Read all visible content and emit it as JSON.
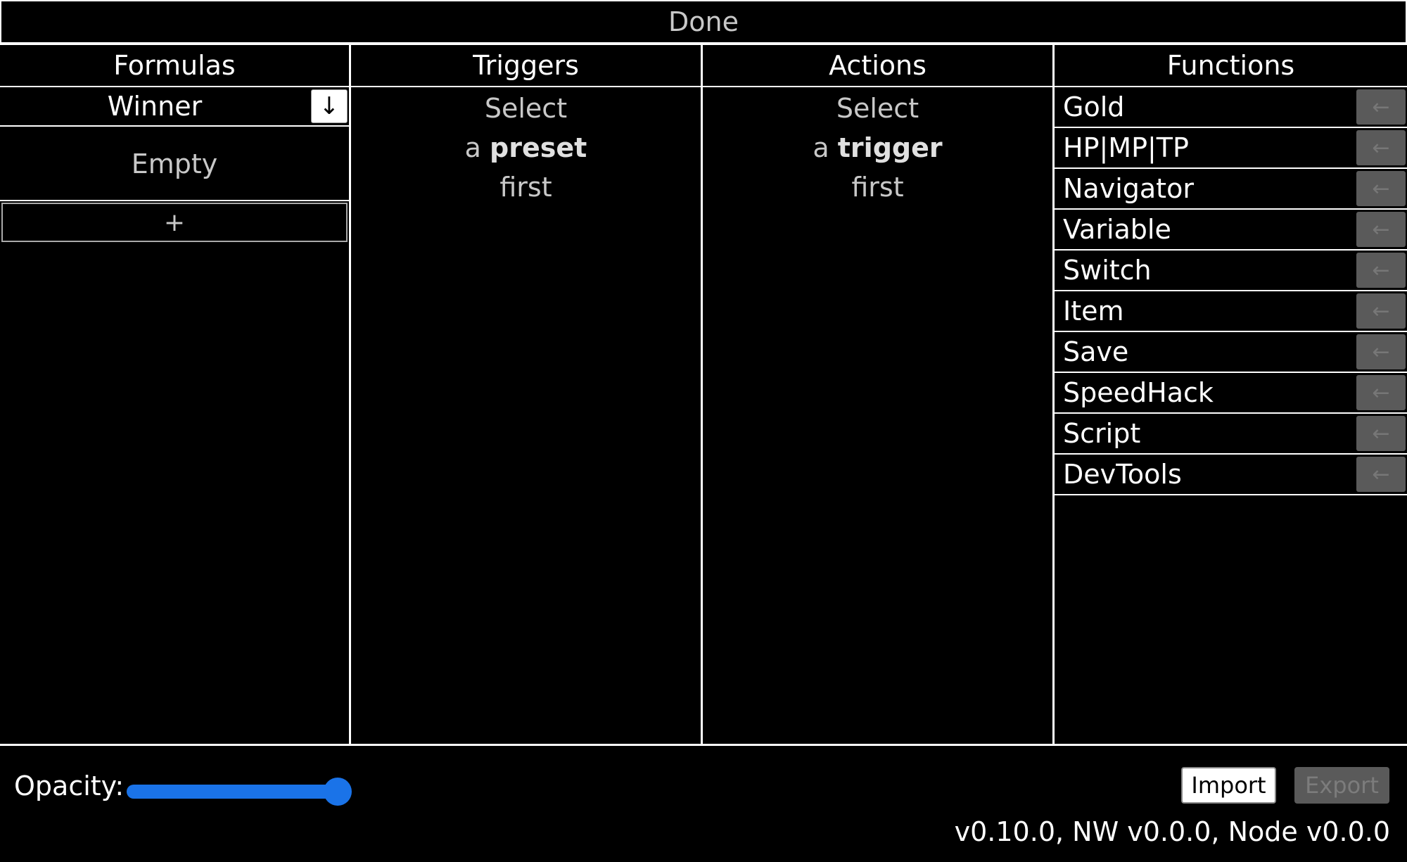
{
  "done_bar": {
    "label": "Done"
  },
  "columns": {
    "formulas": {
      "title": "Formulas",
      "selected": "Winner",
      "download_icon": "↓",
      "empty_text": "Empty",
      "add_label": "+"
    },
    "triggers": {
      "title": "Triggers",
      "hint": [
        "Select",
        "a",
        "preset",
        "first"
      ]
    },
    "actions": {
      "title": "Actions",
      "hint": [
        "Select",
        "a",
        "trigger",
        "first"
      ]
    },
    "functions": {
      "title": "Functions",
      "button_icon": "←",
      "items": [
        "Gold",
        "HP|MP|TP",
        "Navigator",
        "Variable",
        "Switch",
        "Item",
        "Save",
        "SpeedHack",
        "Script",
        "DevTools"
      ]
    }
  },
  "footer": {
    "opacity_label": "Opacity:",
    "opacity_value": 1.0,
    "import_label": "Import",
    "export_label": "Export",
    "version_text": "v0.10.0, NW v0.0.0, Node v0.0.0"
  },
  "colors": {
    "accent": "#1a73e8",
    "background": "#000000",
    "disabled_button": "#5a5a5a"
  }
}
